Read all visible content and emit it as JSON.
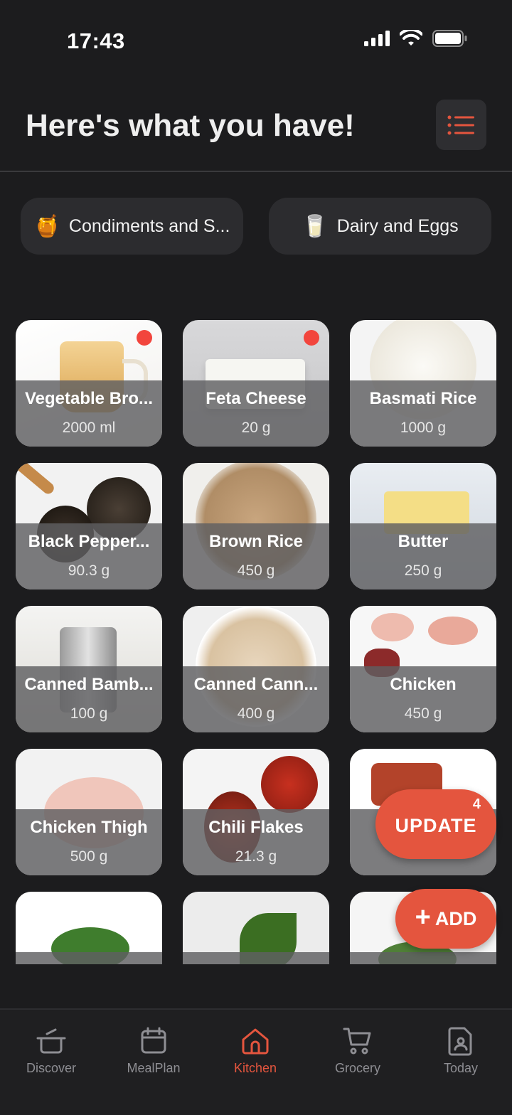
{
  "status_bar": {
    "time": "17:43"
  },
  "header": {
    "title": "Here's what you have!"
  },
  "categories": [
    {
      "emoji": "🍯",
      "label": "Condiments and S..."
    },
    {
      "emoji": "🥛",
      "label": "Dairy and Eggs"
    }
  ],
  "items": [
    {
      "name": "Vegetable Bro...",
      "qty": "2000 ml"
    },
    {
      "name": "Feta Cheese",
      "qty": "20 g"
    },
    {
      "name": "Basmati Rice",
      "qty": "1000 g"
    },
    {
      "name": "Black Pepper...",
      "qty": "90.3 g"
    },
    {
      "name": "Brown Rice",
      "qty": "450 g"
    },
    {
      "name": "Butter",
      "qty": "250 g"
    },
    {
      "name": "Canned Bamb...",
      "qty": "100 g"
    },
    {
      "name": "Canned Cann...",
      "qty": "400 g"
    },
    {
      "name": "Chicken",
      "qty": "450 g"
    },
    {
      "name": "Chicken Thigh",
      "qty": "500 g"
    },
    {
      "name": "Chili Flakes",
      "qty": "21.3 g"
    }
  ],
  "fab": {
    "update_label": "UPDATE",
    "update_count": "4",
    "add_label": "ADD"
  },
  "tabs": [
    {
      "label": "Discover",
      "icon": "pot-icon"
    },
    {
      "label": "MealPlan",
      "icon": "calendar-icon"
    },
    {
      "label": "Kitchen",
      "icon": "home-icon"
    },
    {
      "label": "Grocery",
      "icon": "cart-icon"
    },
    {
      "label": "Today",
      "icon": "document-person-icon"
    }
  ],
  "colors": {
    "accent": "#e4553e",
    "background": "#1c1c1e",
    "badge": "#f2453d"
  }
}
